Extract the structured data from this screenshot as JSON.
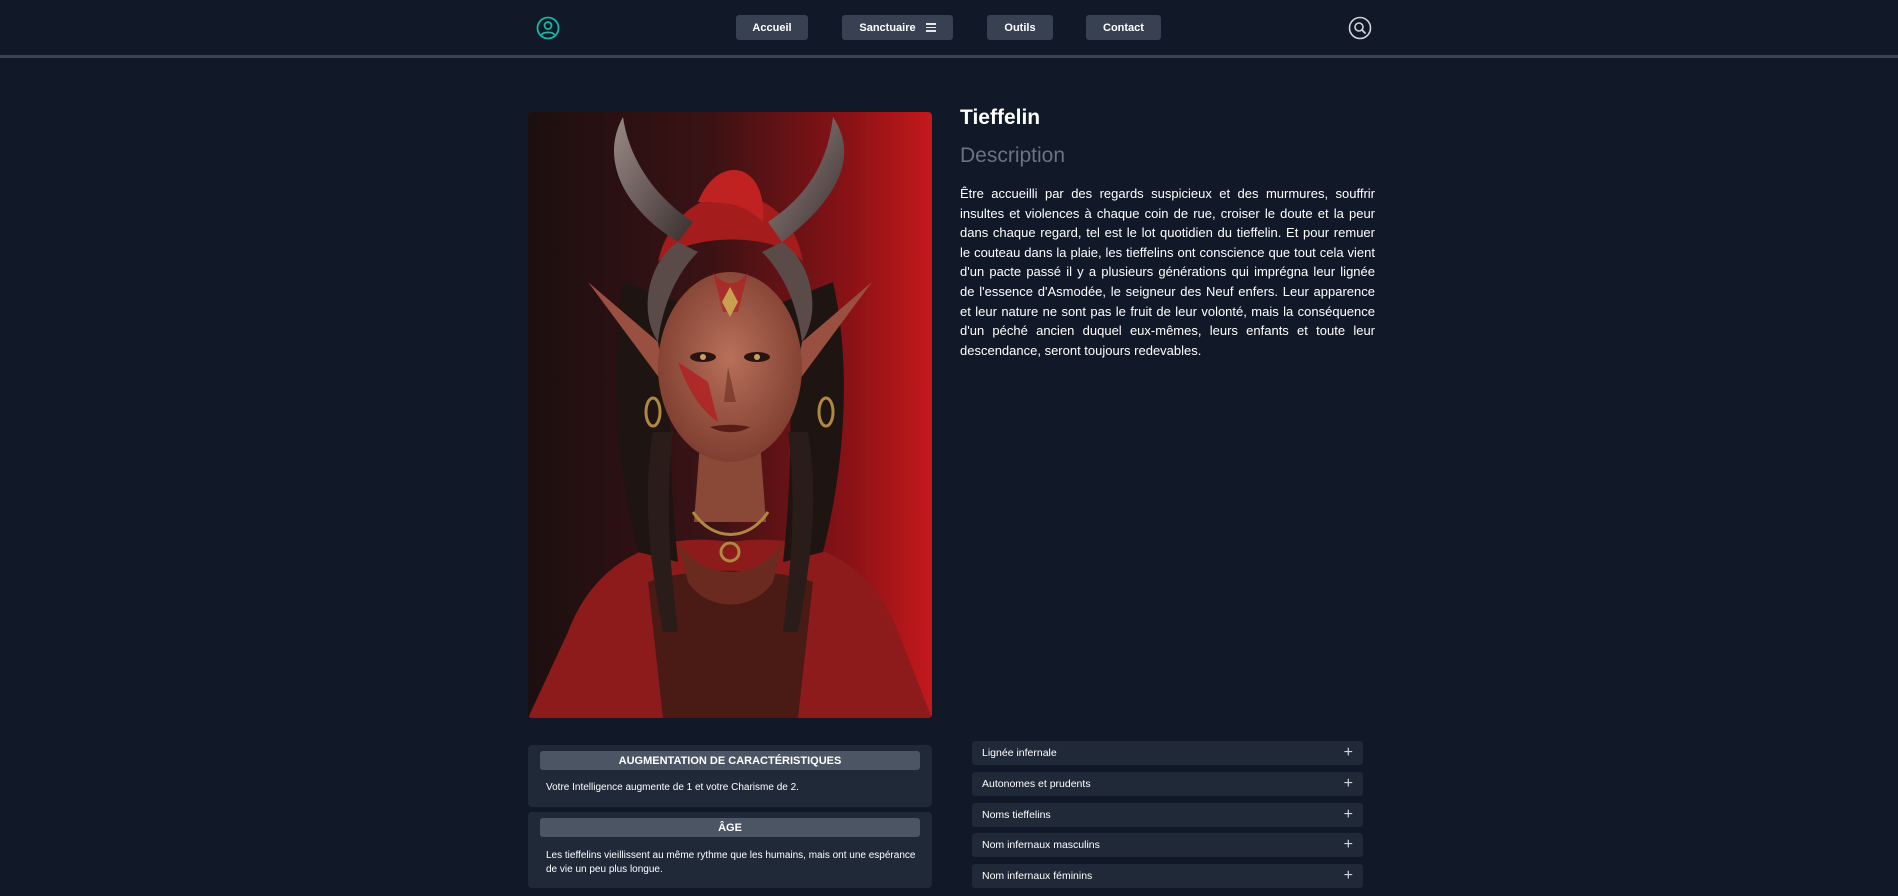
{
  "nav": {
    "user_icon": "user-circle-icon",
    "search_icon": "search-icon",
    "accueil": "Accueil",
    "sanctuaire": "Sanctuaire",
    "outils": "Outils",
    "contact": "Contact"
  },
  "portrait": {
    "subject": "Tieffelin"
  },
  "race": {
    "title": "Tieffelin",
    "description_heading": "Description",
    "description": "Être accueilli par des regards suspicieux et des murmures, souffrir insultes et violences à chaque coin de rue, croiser le doute et la peur dans chaque regard, tel est le lot quotidien du tieffelin. Et pour remuer le couteau dans la plaie, les tieffelins ont conscience que tout cela vient d'un pacte passé il y a plusieurs générations qui imprégna leur lignée de l'essence d'Asmodée, le seigneur des Neuf enfers. Leur apparence et leur nature ne sont pas le fruit de leur volonté, mais la conséquence d'un péché ancien duquel eux-mêmes, leurs enfants et toute leur descendance, seront toujours redevables."
  },
  "traits": [
    {
      "heading": "AUGMENTATION DE CARACTÉRISTIQUES",
      "text": "Votre Intelligence augmente de 1 et votre Charisme de 2."
    },
    {
      "heading": "ÂGE",
      "text": "Les tieffelins vieillissent au même rythme que les humains, mais ont une espérance de vie un peu plus longue."
    }
  ],
  "accordion": [
    {
      "label": "Lignée infernale"
    },
    {
      "label": "Autonomes et prudents"
    },
    {
      "label": "Noms tieffelins"
    },
    {
      "label": "Nom infernaux masculins"
    },
    {
      "label": "Nom infernaux féminins"
    }
  ],
  "accordion_icon": "plus-icon",
  "colors": {
    "background": "#111827",
    "button": "#374151",
    "card": "#1f2937",
    "accent_teal": "#14b8a6"
  }
}
